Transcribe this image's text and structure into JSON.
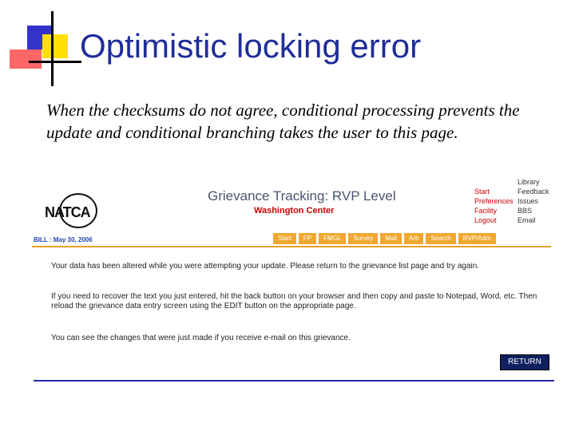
{
  "slide": {
    "title": "Optimistic locking error",
    "body": "When the checksums do not agree, conditional processing prevents the update and conditional branching takes the user to this page."
  },
  "app": {
    "logo_text": "NATCA",
    "title": "Grievance Tracking: RVP Level",
    "subtitle": "Washington Center",
    "date": "BILL : May 30, 2006",
    "nav_left": [
      "Start",
      "Preferences",
      "Facility",
      "Logout"
    ],
    "nav_right": [
      "Library",
      "Feedback",
      "Issues",
      "BBS",
      "Email"
    ],
    "tabs": [
      "Start",
      "FP",
      "FMGL",
      "Survey",
      "Mail",
      "Arb",
      "Search",
      "RVP/Adm"
    ],
    "messages": [
      "Your data has been altered while you were attempting your update. Please return to the grievance list page and try again.",
      "If you need to recover the text you just entered, hit the back button on your browser and then copy and paste to Notepad, Word, etc. Then reload the grievance data entry screen using the EDIT button on the appropriate page.",
      "You can see the changes that were just made if you receive e-mail on this grievance."
    ],
    "return_label": "RETURN"
  },
  "colors": {
    "title": "#1f2d9a",
    "accent": "#f0a830",
    "subtitle": "#cc0000",
    "button": "#102060"
  }
}
